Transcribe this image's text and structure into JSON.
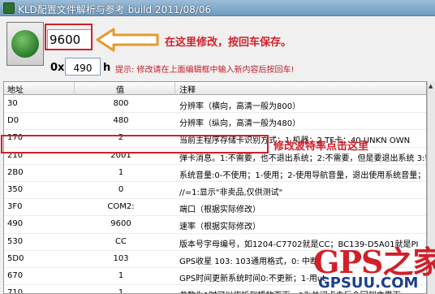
{
  "window": {
    "title": "KLD配置文件解析与参考 build 2011/08/06"
  },
  "editor": {
    "value": "9600",
    "prefix_label": "0x",
    "address": "490",
    "suffix_label": "h",
    "hint": "提示: 修改请在上面编辑框中输入新内容后按回车!"
  },
  "annotations": {
    "top": "在这里修改，按回车保存。",
    "middle": "修改波特率点击这里"
  },
  "table": {
    "columns": [
      "地址",
      "值",
      "注释"
    ],
    "rows": [
      {
        "addr": "30",
        "value": "800",
        "note": "分辨率（横向，高清一般为800）"
      },
      {
        "addr": "D0",
        "value": "480",
        "note": "分辨率（纵向，高清一般为480）"
      },
      {
        "addr": "170",
        "value": "2",
        "note": "当前主程序存储卡识别方式：1 机器；2 TF卡；40 UNKN OWN"
      },
      {
        "addr": "210",
        "value": "2001",
        "note": "弹卡消息。1:不需要，也不退出系统；2:不需要，但是要退出系统 3:需要，"
      },
      {
        "addr": "2B0",
        "value": "1",
        "note": "系统音量:0-不使用；1-使用；2-使用导航音量，退出使用系统音量；3-导"
      },
      {
        "addr": "350",
        "value": "0",
        "note": "//=1:显示\"非卖品,仅供测试\""
      },
      {
        "addr": "3F0",
        "value": "COM2:",
        "note": "端口（根据实际修改）"
      },
      {
        "addr": "490",
        "value": "9600",
        "note": "速率（根据实际修改）"
      },
      {
        "addr": "530",
        "value": "CC",
        "note": "版本号字母编号，如1204-C7702就是CC；BC139-D5A01就是PI"
      },
      {
        "addr": "5D0",
        "value": "103",
        "note": "GPS收星 103: 103通用格式，0: 中断，"
      },
      {
        "addr": "670",
        "value": "1",
        "note": "GPS时间更新系统时间0:不更新；1-用ut"
      },
      {
        "addr": "710",
        "value": "1",
        "note": "参数为1时可以临听到播放页面，0为关闭点击后会回到主界面"
      }
    ]
  },
  "watermark": {
    "big": "GPS之家",
    "small": "GPSUU.COM"
  }
}
